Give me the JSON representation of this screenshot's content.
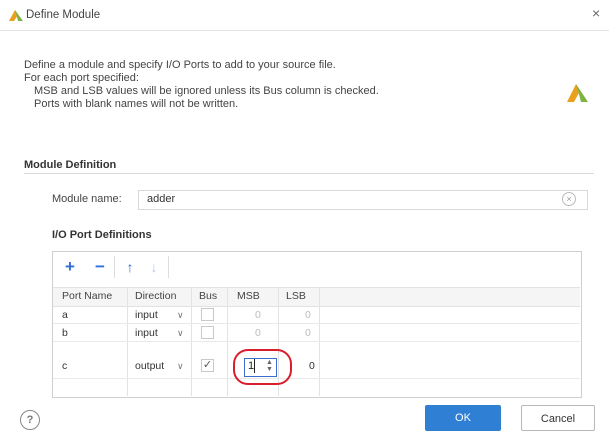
{
  "window": {
    "title": "Define Module",
    "close_glyph": "×"
  },
  "description": {
    "line1": "Define a module and specify I/O Ports to add to your source file.",
    "line2": "For each port specified:",
    "line3": "MSB and LSB values will be ignored unless its Bus column is checked.",
    "line4": "Ports with blank names will not be written."
  },
  "module_definition": {
    "heading": "Module Definition",
    "name_label": "Module name:",
    "name_value": "adder",
    "clear_glyph": "×"
  },
  "io_ports": {
    "heading": "I/O Port Definitions",
    "toolbar": {
      "add": "+",
      "remove": "−",
      "move_up": "↑",
      "move_down": "↓"
    },
    "columns": [
      "Port Name",
      "Direction",
      "Bus",
      "MSB",
      "LSB"
    ],
    "rows": [
      {
        "port_name": "a",
        "direction": "input",
        "bus": false,
        "msb": "0",
        "lsb": "0"
      },
      {
        "port_name": "b",
        "direction": "input",
        "bus": false,
        "msb": "0",
        "lsb": "0"
      },
      {
        "port_name": "c",
        "direction": "output",
        "bus": true,
        "msb": "1",
        "lsb": "0"
      }
    ]
  },
  "buttons": {
    "help": "?",
    "ok": "OK",
    "cancel": "Cancel"
  },
  "colors": {
    "accent": "#2f80d4",
    "highlight": "#d91e2e"
  }
}
